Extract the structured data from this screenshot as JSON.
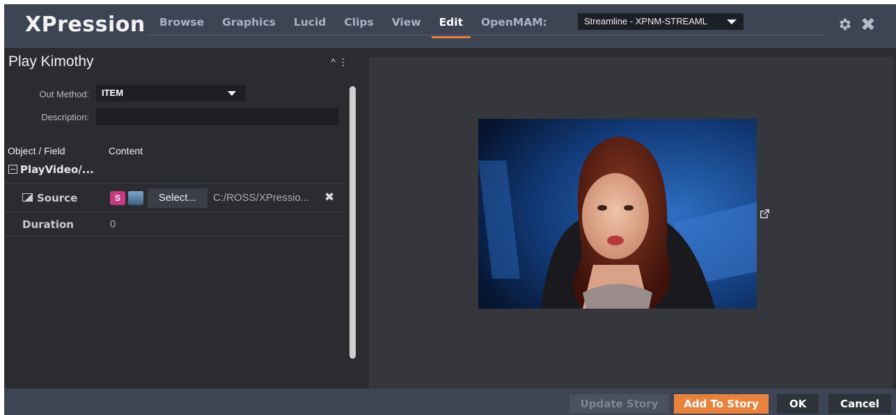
{
  "app": {
    "title": "XPression"
  },
  "nav": {
    "items": [
      {
        "label": "Browse"
      },
      {
        "label": "Graphics"
      },
      {
        "label": "Lucid"
      },
      {
        "label": "Clips"
      },
      {
        "label": "View"
      },
      {
        "label": "Edit",
        "active": true
      },
      {
        "label": "OpenMAM:"
      }
    ],
    "mam_select_value": "Streamline - XPNM-STREAML"
  },
  "panel": {
    "title": "Play Kimothy",
    "out_method_label": "Out Method:",
    "out_method_value": "ITEM",
    "description_label": "Description:",
    "description_value": "",
    "col_object": "Object / Field",
    "col_content": "Content",
    "group_label": "PlayVideo/...",
    "source_label": "Source",
    "source_select_label": "Select...",
    "source_path": "C:/ROSS/XPressio...",
    "duration_label": "Duration",
    "duration_value": "0"
  },
  "footer": {
    "update_story": "Update Story",
    "add_to_story": "Add To Story",
    "ok": "OK",
    "cancel": "Cancel"
  },
  "colors": {
    "accent": "#e8823c",
    "topbar": "#3d4453",
    "panel": "#2a2c30"
  }
}
